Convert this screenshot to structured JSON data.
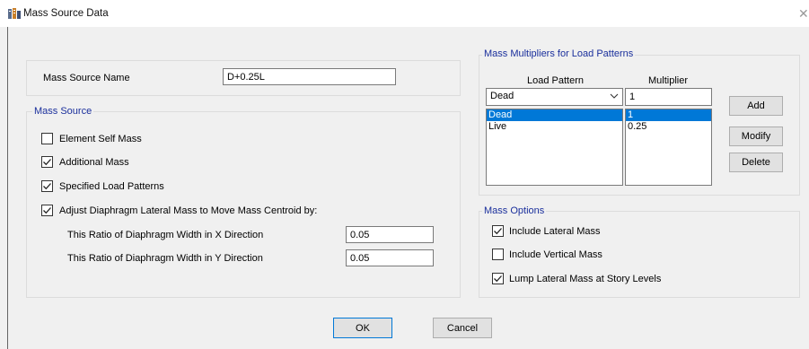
{
  "window": {
    "title": "Mass Source Data"
  },
  "mass_source_name": {
    "label": "Mass Source Name",
    "value": "D+0.25L"
  },
  "mass_source_group": {
    "title": "Mass Source",
    "options": [
      {
        "label": "Element Self Mass",
        "checked": false
      },
      {
        "label": "Additional Mass",
        "checked": true
      },
      {
        "label": "Specified Load Patterns",
        "checked": true
      },
      {
        "label": "Adjust Diaphragm Lateral Mass to Move Mass Centroid by:",
        "checked": true
      }
    ],
    "ratio_x": {
      "label": "This Ratio of Diaphragm Width in X Direction",
      "value": "0.05"
    },
    "ratio_y": {
      "label": "This Ratio of Diaphragm Width in Y Direction",
      "value": "0.05"
    }
  },
  "multipliers_group": {
    "title": "Mass Multipliers for Load Patterns",
    "col_load_pattern": "Load Pattern",
    "col_multiplier": "Multiplier",
    "selected_pattern": "Dead",
    "multiplier_value": "1",
    "rows": [
      {
        "pattern": "Dead",
        "multiplier": "1",
        "selected": true
      },
      {
        "pattern": "Live",
        "multiplier": "0.25",
        "selected": false
      }
    ],
    "add_label": "Add",
    "modify_label": "Modify",
    "delete_label": "Delete"
  },
  "mass_options": {
    "title": "Mass Options",
    "options": [
      {
        "label": "Include Lateral Mass",
        "checked": true
      },
      {
        "label": "Include Vertical Mass",
        "checked": false
      },
      {
        "label": "Lump Lateral Mass at Story Levels",
        "checked": true
      }
    ]
  },
  "footer": {
    "ok_label": "OK",
    "cancel_label": "Cancel"
  },
  "icons": {
    "app": "building-app-icon",
    "close": "close-icon",
    "dropdown": "chevron-down-icon",
    "check": "checkmark-icon"
  }
}
